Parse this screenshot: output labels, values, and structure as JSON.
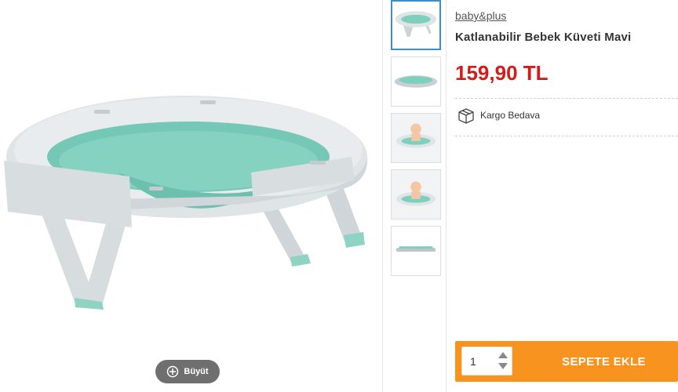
{
  "product": {
    "brand": "baby&plus",
    "title": "Katlanabilir Bebek Küveti Mavi",
    "price": "159,90 TL",
    "shipping_label": "Kargo Bedava",
    "shipping_icon": "box-icon"
  },
  "gallery": {
    "zoom_label": "Büyüt",
    "zoom_icon": "plus-circle-icon",
    "thumbnail_count": 5,
    "active_thumbnail": 1
  },
  "cart": {
    "quantity": "1",
    "add_to_cart_label": "SEPETE EKLE"
  },
  "colors": {
    "price": "#d51a1a",
    "cart_bar": "#f7931e",
    "active_thumb_border": "#3b8fc4",
    "tub_outer": "#e3e7ea",
    "tub_inner": "#7fcfbf"
  }
}
